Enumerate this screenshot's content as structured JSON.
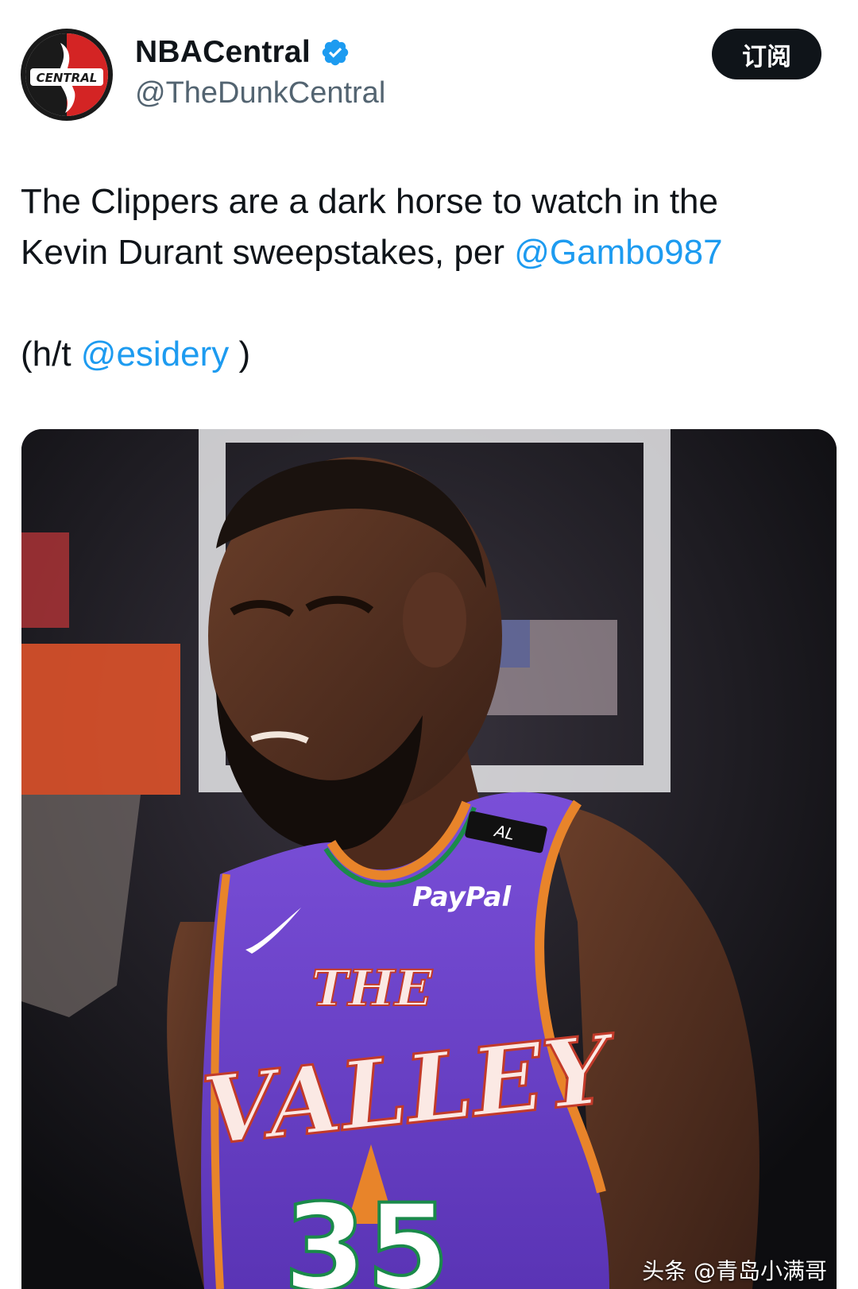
{
  "account": {
    "display_name": "NBACentral",
    "handle": "@TheDunkCentral",
    "avatar_icon": "nba-central-logo-icon",
    "verified_icon": "verified-badge-icon",
    "verified_color": "#1d9bf0"
  },
  "subscribe_button": {
    "label": "订阅"
  },
  "tweet": {
    "line1": "The Clippers are a dark horse to watch in the",
    "line2_text": "Kevin Durant sweepstakes, per ",
    "line2_mention": "@Gambo987",
    "ht_prefix": "(h/t ",
    "ht_mention": "@esidery",
    "ht_suffix": " )"
  },
  "media": {
    "jersey_text_top": "THE",
    "jersey_text_main": "VALLEY",
    "jersey_sponsor": "PayPal",
    "jersey_number": "35",
    "jersey_patch": "AL",
    "watermark": "头条 @青岛小满哥"
  },
  "colors": {
    "link": "#1d9bf0",
    "jersey_purple": "#6a3fc9",
    "button_bg": "#0f1419"
  }
}
